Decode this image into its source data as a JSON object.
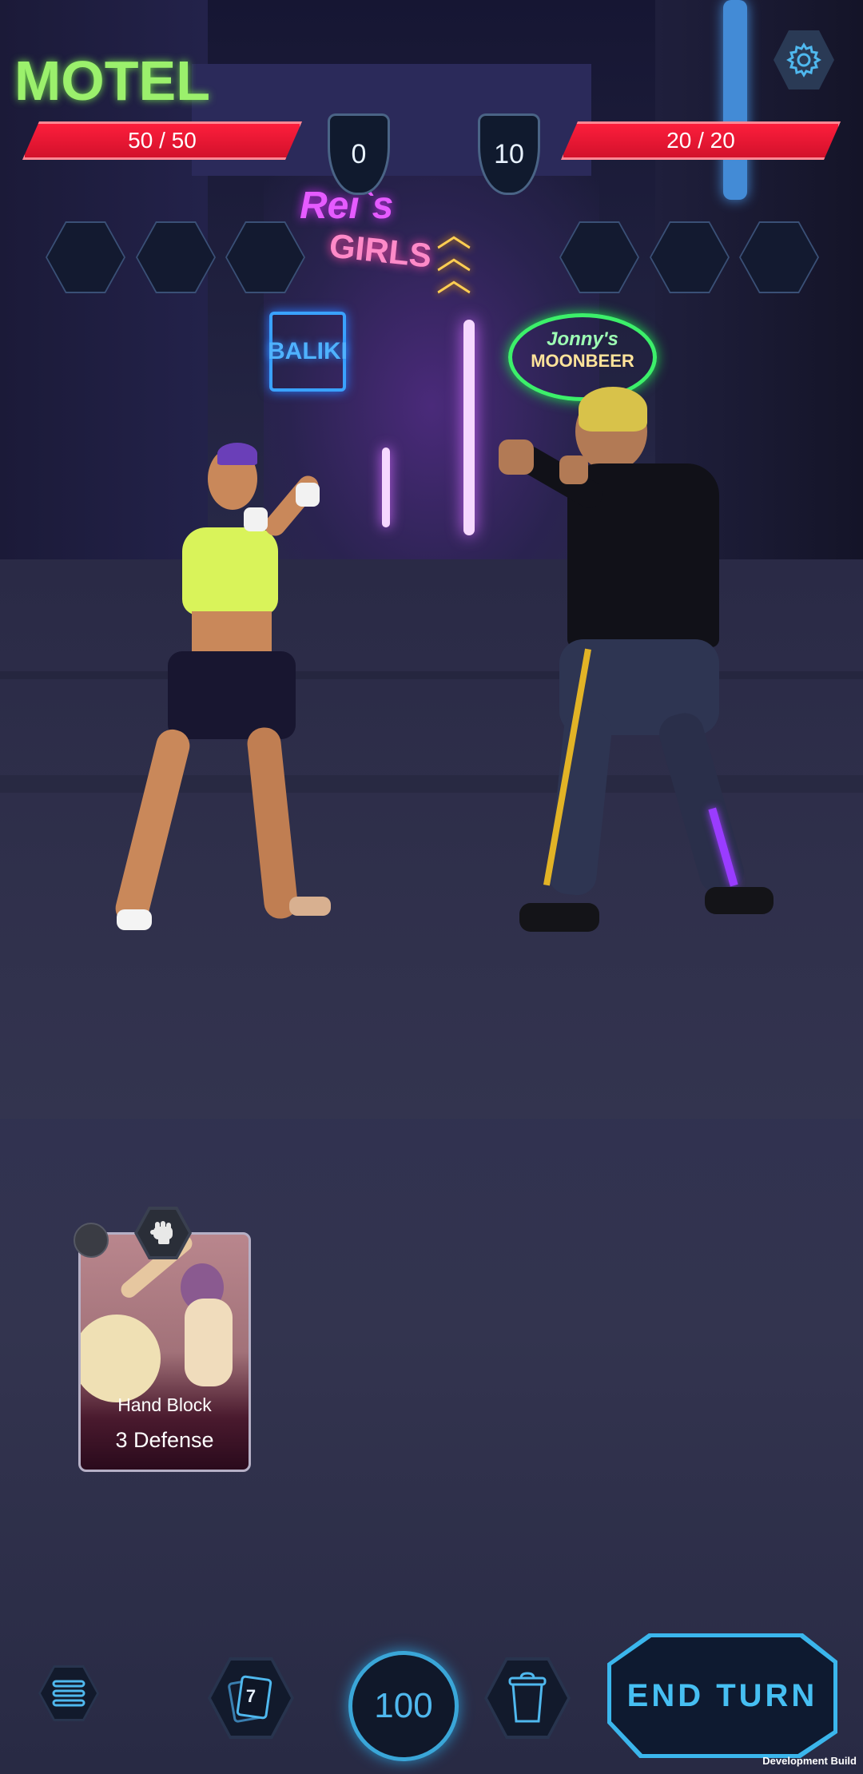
{
  "player": {
    "health_text": "50  / 50",
    "block": "0"
  },
  "enemy": {
    "health_text": "20  / 20",
    "block": "10"
  },
  "background_signs": {
    "motel": "MOTEL",
    "reis_girls": "Rei`s",
    "girls": "GIRLS",
    "baliki": "BALIKI",
    "jonnys": "Jonny's",
    "moonbeer": "MOONBEER"
  },
  "card": {
    "name": "Hand Block",
    "effect": "3 Defense",
    "type_icon": "fist-icon"
  },
  "bottom_bar": {
    "draw_pile_count": "7",
    "energy": "100",
    "end_turn_label": "END TURN"
  },
  "dev_label": "Development Build",
  "colors": {
    "accent": "#3bb6ec",
    "health": "#e8122e",
    "panel": "#121a2c"
  }
}
